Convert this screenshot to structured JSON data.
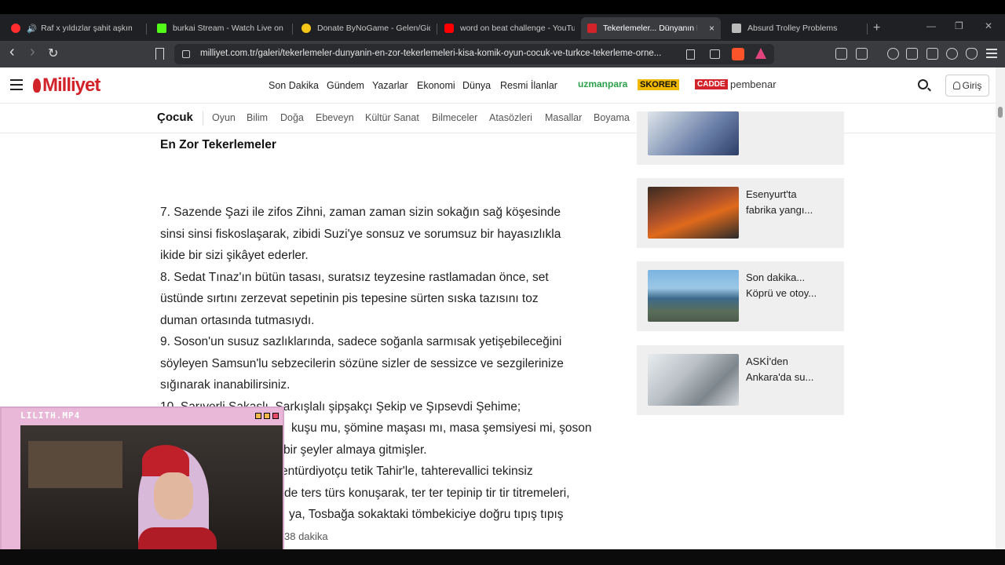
{
  "tabs": [
    {
      "title": "Raf x yıldızlar şahit aşkıma -",
      "favicon_color": "#ff2d2d"
    },
    {
      "title": "burkai Stream - Watch Live on K",
      "favicon_color": "#53fc18"
    },
    {
      "title": "Donate ByNoGame - Gelen/Gide",
      "favicon_color": "#f5c518"
    },
    {
      "title": "word on beat challenge - YouTu",
      "favicon_color": "#ff0000"
    },
    {
      "title": "Tekerlemeler... Dünyanın En",
      "favicon_color": "#d2232a",
      "active": true
    },
    {
      "title": "Absurd Trolley Problems",
      "favicon_color": "#bbbbbb"
    }
  ],
  "tab_close": "×",
  "new_tab": "+",
  "window_controls": {
    "minimize": "—",
    "restore": "❐",
    "close": "✕"
  },
  "nav": {
    "back": "‹",
    "forward": "›",
    "reload": "↻"
  },
  "url": "milliyet.com.tr/galeri/tekerlemeler-dunyanin-en-zor-tekerlemeleri-kisa-komik-oyun-cocuk-ve-turkce-tekerleme-orne...",
  "site": {
    "logo": "Milliyet",
    "menu": [
      "Son Dakika",
      "Gündem",
      "Yazarlar",
      "Ekonomi",
      "Dünya",
      "Resmi İlanlar"
    ],
    "brands": [
      {
        "label": "uzmanpara",
        "color": "#2aa14a"
      },
      {
        "label": "SKORER",
        "color": "#f0b800"
      },
      {
        "label": "CADDE",
        "color": "#d2232a"
      },
      {
        "label": "pembenar",
        "color": "#333333"
      }
    ],
    "login": "Giriş"
  },
  "subnav": {
    "title": "Çocuk",
    "items": [
      "Oyun",
      "Bilim",
      "Doğa",
      "Ebeveyn",
      "Kültür Sanat",
      "Bilmeceler",
      "Atasözleri",
      "Masallar",
      "Boyama"
    ]
  },
  "article": {
    "heading": "En Zor Tekerlemeler",
    "lines": [
      "7. Sazende Şazi ile zifos Zihni, zaman zaman sizin sokağın sağ köşesinde",
      "sinsi sinsi fiskoslaşarak, zibidi Suzi'ye sonsuz ve sorumsuz bir hayasızlıkla",
      "ikide bir sizi şikâyet ederler.",
      "8. Sedat Tınaz'ın bütün tasası, suratsız teyzesine rastlamadan önce, set",
      "üstünde sırtını zerzevat sepetinin pis tepesine sürten sıska tazısını toz",
      "duman ortasında tutmasıydı.",
      "9. Soson'un susuz sazlıklarında, sadece soğanla sarmısak yetişebileceğini",
      "söyleyen Samsun'lu sebzecilerin sözüne sizler de sessizce ve sezgilerinize",
      "sığınarak inanabilirsiniz.",
      "10. Sarıyerli Şakaşlı, Şarkışlalı şipşakçı Şekip ve Şıpsevdi Şehime;",
      "kuşu mu, şömine maşası mı, masa şemsiyesi mi, şoson",
      "bir şeyler almaya gitmişler.",
      "entürdiyotçu tetik Tahir'le, tahterevallici tekinsiz",
      "de ters türs konuşarak, ter ter tepinip tir tir titremeleri,",
      "ya, Tosbağa sokaktaki tömbekiciye doğru tıpış tıpış",
      "38 dakika"
    ]
  },
  "sidebar": [
    {
      "title_l1": "",
      "title_l2": ""
    },
    {
      "title_l1": "Esenyurt'ta",
      "title_l2": "fabrika yangı..."
    },
    {
      "title_l1": "Son dakika...",
      "title_l2": "Köprü ve otoy..."
    },
    {
      "title_l1": "ASKİ'den",
      "title_l2": "Ankara'da su..."
    }
  ],
  "webcam": {
    "title": "LILITH.MP4"
  }
}
